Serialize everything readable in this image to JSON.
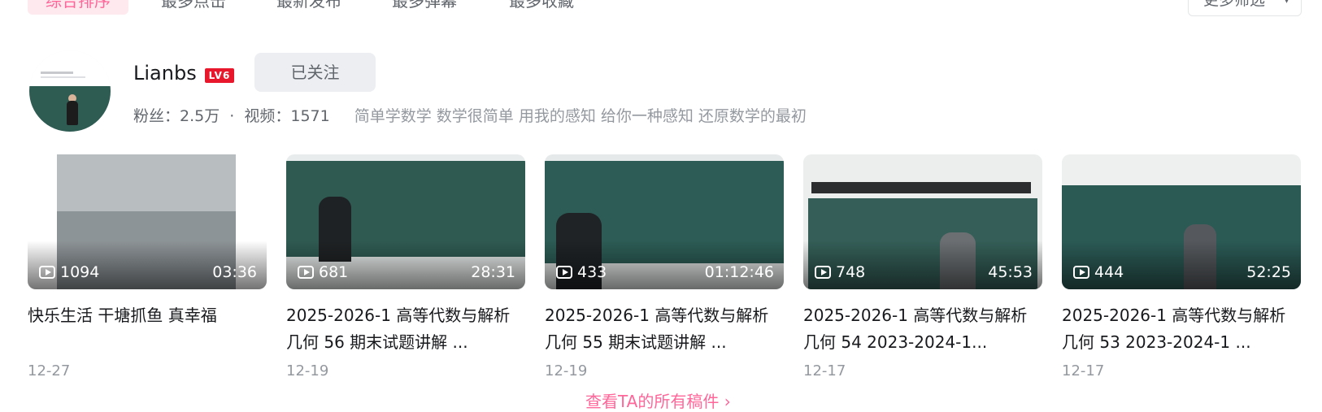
{
  "sort_tabs": [
    {
      "label": "综合排序",
      "active": true
    },
    {
      "label": "最多点击",
      "active": false
    },
    {
      "label": "最新发布",
      "active": false
    },
    {
      "label": "最多弹幕",
      "active": false
    },
    {
      "label": "最多收藏",
      "active": false
    }
  ],
  "filter": {
    "label": "更多筛选",
    "icon": "chevron-down-icon"
  },
  "user": {
    "name": "Lianbs",
    "level_badge": "LV6",
    "follow_label": "已关注",
    "fans_label": "粉丝：2.5万",
    "videos_label": "视频：1571",
    "separator": "·",
    "sign": "简单学数学 数学很简单 用我的感知 给你一种感知 还原数学的最初"
  },
  "videos": [
    {
      "plays": "1094",
      "duration": "03:36",
      "title": "快乐生活 干塘抓鱼 真幸福",
      "date": "12-27",
      "thumb": "#8d9497"
    },
    {
      "plays": "681",
      "duration": "28:31",
      "title": "2025-2026-1 高等代数与解析几何 56 期末试题讲解 ...",
      "date": "12-19",
      "thumb": "#2f5a52"
    },
    {
      "plays": "433",
      "duration": "01:12:46",
      "title": "2025-2026-1 高等代数与解析几何 55 期末试题讲解 ...",
      "date": "12-19",
      "thumb": "#2c5c55"
    },
    {
      "plays": "748",
      "duration": "45:53",
      "title": "2025-2026-1 高等代数与解析几何 54 2023-2024-1...",
      "date": "12-17",
      "thumb": "#345e57"
    },
    {
      "plays": "444",
      "duration": "52:25",
      "title": "2025-2026-1 高等代数与解析几何 53 2023-2024-1 ...",
      "date": "12-17",
      "thumb": "#2b5a55"
    }
  ],
  "more_link": "查看TA的所有稿件 ›",
  "colors": {
    "accent": "#ff6699",
    "muted": "#9499a0",
    "badge": "#e8172c"
  }
}
